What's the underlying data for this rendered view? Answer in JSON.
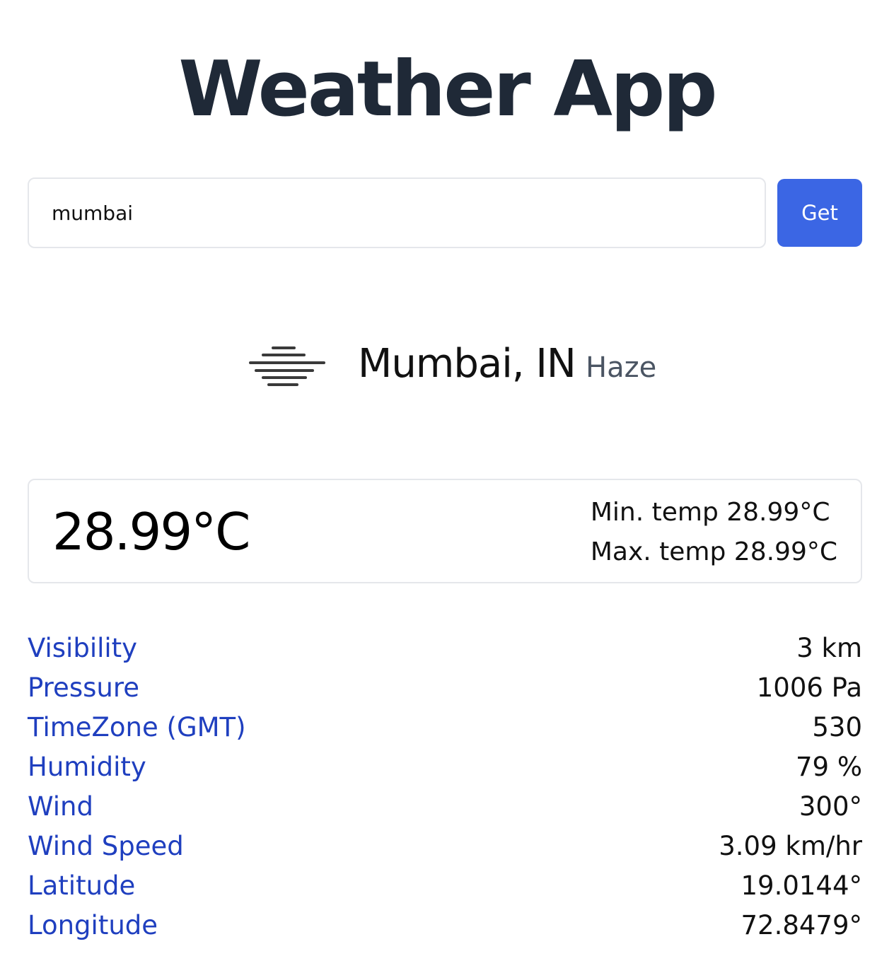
{
  "app": {
    "title": "Weather App"
  },
  "search": {
    "value": "mumbai",
    "button_label": "Get"
  },
  "current": {
    "icon": "haze-icon",
    "city": "Mumbai, IN",
    "condition": "Haze",
    "temperature": "28.99°C",
    "min_temp": "Min. temp 28.99°C",
    "max_temp": "Max. temp 28.99°C"
  },
  "details": [
    {
      "label": "Visibility",
      "value": "3 km"
    },
    {
      "label": "Pressure",
      "value": "1006 Pa"
    },
    {
      "label": "TimeZone (GMT)",
      "value": "530"
    },
    {
      "label": "Humidity",
      "value": "79 %"
    },
    {
      "label": "Wind",
      "value": "300°"
    },
    {
      "label": "Wind Speed",
      "value": "3.09 km/hr"
    },
    {
      "label": "Latitude",
      "value": "19.0144°"
    },
    {
      "label": "Longitude",
      "value": "72.8479°"
    }
  ],
  "colors": {
    "accent": "#3b66e4",
    "label": "#1f3fbf",
    "title": "#1f2937",
    "condition": "#4b5563",
    "border": "#e5e7eb"
  }
}
